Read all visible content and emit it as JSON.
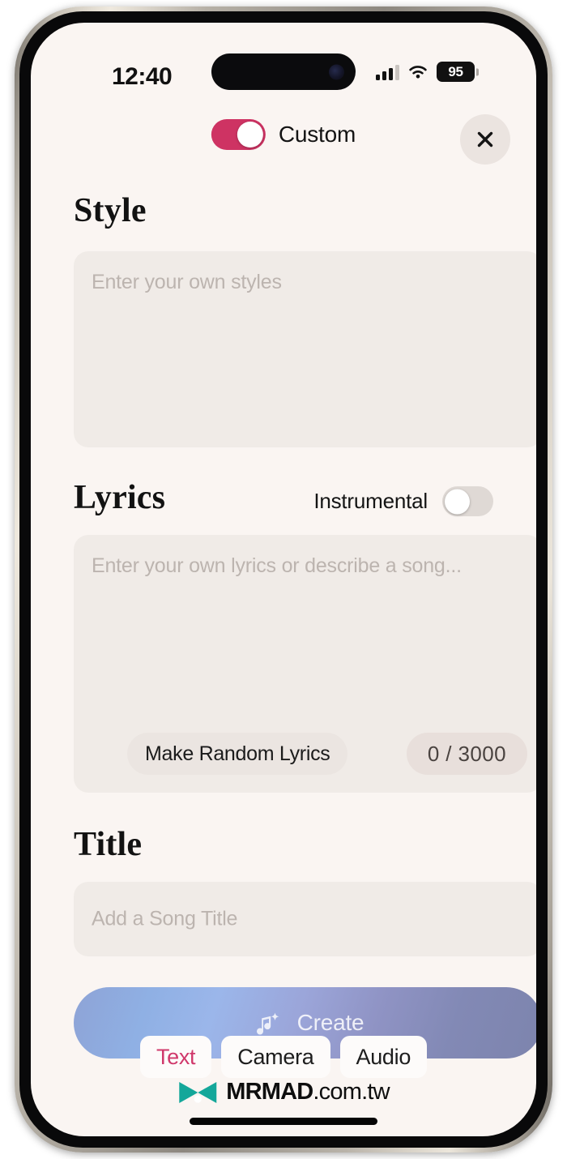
{
  "status_bar": {
    "time": "12:40",
    "signal_icon": "cellular-bars-icon",
    "wifi_icon": "wifi-icon",
    "battery_level": "95"
  },
  "header": {
    "custom_label": "Custom",
    "custom_toggle_state": "on",
    "close_icon": "close-icon"
  },
  "sections": {
    "style": {
      "heading": "Style",
      "placeholder": "Enter your own styles"
    },
    "lyrics": {
      "heading": "Lyrics",
      "instrumental_label": "Instrumental",
      "instrumental_toggle_state": "off",
      "placeholder": "Enter your own lyrics or describe a song...",
      "random_button_label": "Make Random Lyrics",
      "char_counter": "0 / 3000"
    },
    "title": {
      "heading": "Title",
      "placeholder": "Add a Song Title"
    }
  },
  "create_button": {
    "label": "Create",
    "icon": "music-note-sparkle-icon"
  },
  "tab_bar": {
    "tabs": [
      {
        "label": "Text",
        "active": true
      },
      {
        "label": "Camera",
        "active": false
      },
      {
        "label": "Audio",
        "active": false
      }
    ]
  },
  "watermark": {
    "brand": "MRMAD",
    "tld": ".com.tw",
    "logo_icon": "mrmad-infinity-logo-icon"
  },
  "colors": {
    "accent_pink": "#ce3363",
    "tab_active_pink": "#d0386b",
    "page_background": "#faf5f2",
    "field_background": "#f0ebe7",
    "create_gradient_start": "#8fb0e4",
    "create_gradient_end": "#7d84ad",
    "watermark_teal": "#14a79a"
  }
}
